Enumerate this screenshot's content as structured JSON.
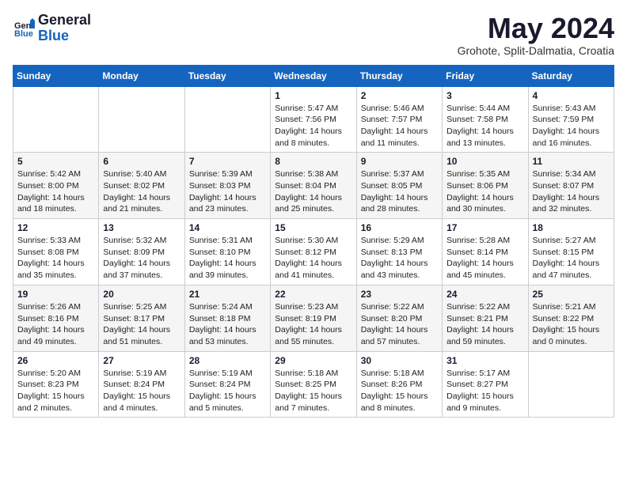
{
  "header": {
    "logo_general": "General",
    "logo_blue": "Blue",
    "month_title": "May 2024",
    "location": "Grohote, Split-Dalmatia, Croatia"
  },
  "days_of_week": [
    "Sunday",
    "Monday",
    "Tuesday",
    "Wednesday",
    "Thursday",
    "Friday",
    "Saturday"
  ],
  "weeks": [
    [
      {
        "day": null,
        "info": null
      },
      {
        "day": null,
        "info": null
      },
      {
        "day": null,
        "info": null
      },
      {
        "day": "1",
        "info": "Sunrise: 5:47 AM\nSunset: 7:56 PM\nDaylight: 14 hours\nand 8 minutes."
      },
      {
        "day": "2",
        "info": "Sunrise: 5:46 AM\nSunset: 7:57 PM\nDaylight: 14 hours\nand 11 minutes."
      },
      {
        "day": "3",
        "info": "Sunrise: 5:44 AM\nSunset: 7:58 PM\nDaylight: 14 hours\nand 13 minutes."
      },
      {
        "day": "4",
        "info": "Sunrise: 5:43 AM\nSunset: 7:59 PM\nDaylight: 14 hours\nand 16 minutes."
      }
    ],
    [
      {
        "day": "5",
        "info": "Sunrise: 5:42 AM\nSunset: 8:00 PM\nDaylight: 14 hours\nand 18 minutes."
      },
      {
        "day": "6",
        "info": "Sunrise: 5:40 AM\nSunset: 8:02 PM\nDaylight: 14 hours\nand 21 minutes."
      },
      {
        "day": "7",
        "info": "Sunrise: 5:39 AM\nSunset: 8:03 PM\nDaylight: 14 hours\nand 23 minutes."
      },
      {
        "day": "8",
        "info": "Sunrise: 5:38 AM\nSunset: 8:04 PM\nDaylight: 14 hours\nand 25 minutes."
      },
      {
        "day": "9",
        "info": "Sunrise: 5:37 AM\nSunset: 8:05 PM\nDaylight: 14 hours\nand 28 minutes."
      },
      {
        "day": "10",
        "info": "Sunrise: 5:35 AM\nSunset: 8:06 PM\nDaylight: 14 hours\nand 30 minutes."
      },
      {
        "day": "11",
        "info": "Sunrise: 5:34 AM\nSunset: 8:07 PM\nDaylight: 14 hours\nand 32 minutes."
      }
    ],
    [
      {
        "day": "12",
        "info": "Sunrise: 5:33 AM\nSunset: 8:08 PM\nDaylight: 14 hours\nand 35 minutes."
      },
      {
        "day": "13",
        "info": "Sunrise: 5:32 AM\nSunset: 8:09 PM\nDaylight: 14 hours\nand 37 minutes."
      },
      {
        "day": "14",
        "info": "Sunrise: 5:31 AM\nSunset: 8:10 PM\nDaylight: 14 hours\nand 39 minutes."
      },
      {
        "day": "15",
        "info": "Sunrise: 5:30 AM\nSunset: 8:12 PM\nDaylight: 14 hours\nand 41 minutes."
      },
      {
        "day": "16",
        "info": "Sunrise: 5:29 AM\nSunset: 8:13 PM\nDaylight: 14 hours\nand 43 minutes."
      },
      {
        "day": "17",
        "info": "Sunrise: 5:28 AM\nSunset: 8:14 PM\nDaylight: 14 hours\nand 45 minutes."
      },
      {
        "day": "18",
        "info": "Sunrise: 5:27 AM\nSunset: 8:15 PM\nDaylight: 14 hours\nand 47 minutes."
      }
    ],
    [
      {
        "day": "19",
        "info": "Sunrise: 5:26 AM\nSunset: 8:16 PM\nDaylight: 14 hours\nand 49 minutes."
      },
      {
        "day": "20",
        "info": "Sunrise: 5:25 AM\nSunset: 8:17 PM\nDaylight: 14 hours\nand 51 minutes."
      },
      {
        "day": "21",
        "info": "Sunrise: 5:24 AM\nSunset: 8:18 PM\nDaylight: 14 hours\nand 53 minutes."
      },
      {
        "day": "22",
        "info": "Sunrise: 5:23 AM\nSunset: 8:19 PM\nDaylight: 14 hours\nand 55 minutes."
      },
      {
        "day": "23",
        "info": "Sunrise: 5:22 AM\nSunset: 8:20 PM\nDaylight: 14 hours\nand 57 minutes."
      },
      {
        "day": "24",
        "info": "Sunrise: 5:22 AM\nSunset: 8:21 PM\nDaylight: 14 hours\nand 59 minutes."
      },
      {
        "day": "25",
        "info": "Sunrise: 5:21 AM\nSunset: 8:22 PM\nDaylight: 15 hours\nand 0 minutes."
      }
    ],
    [
      {
        "day": "26",
        "info": "Sunrise: 5:20 AM\nSunset: 8:23 PM\nDaylight: 15 hours\nand 2 minutes."
      },
      {
        "day": "27",
        "info": "Sunrise: 5:19 AM\nSunset: 8:24 PM\nDaylight: 15 hours\nand 4 minutes."
      },
      {
        "day": "28",
        "info": "Sunrise: 5:19 AM\nSunset: 8:24 PM\nDaylight: 15 hours\nand 5 minutes."
      },
      {
        "day": "29",
        "info": "Sunrise: 5:18 AM\nSunset: 8:25 PM\nDaylight: 15 hours\nand 7 minutes."
      },
      {
        "day": "30",
        "info": "Sunrise: 5:18 AM\nSunset: 8:26 PM\nDaylight: 15 hours\nand 8 minutes."
      },
      {
        "day": "31",
        "info": "Sunrise: 5:17 AM\nSunset: 8:27 PM\nDaylight: 15 hours\nand 9 minutes."
      },
      {
        "day": null,
        "info": null
      }
    ]
  ]
}
